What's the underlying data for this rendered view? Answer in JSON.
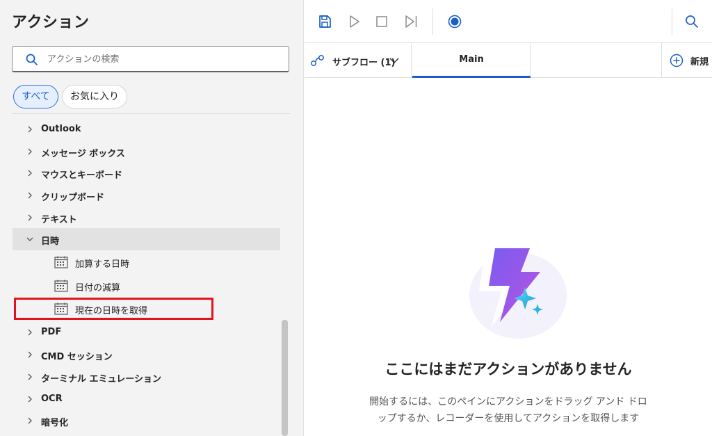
{
  "actions_pane": {
    "title": "アクション",
    "search": {
      "placeholder": "アクションの検索",
      "value": ""
    },
    "filters": [
      {
        "label": "すべて",
        "selected": true
      },
      {
        "label": "お気に入り",
        "selected": false
      }
    ],
    "tree": [
      {
        "label": "Outlook",
        "expanded": false
      },
      {
        "label": "メッセージ ボックス",
        "expanded": false
      },
      {
        "label": "マウスとキーボード",
        "expanded": false
      },
      {
        "label": "クリップボード",
        "expanded": false
      },
      {
        "label": "テキスト",
        "expanded": false
      },
      {
        "label": "日時",
        "expanded": true
      },
      {
        "label": "PDF",
        "expanded": false
      },
      {
        "label": "CMD セッション",
        "expanded": false
      },
      {
        "label": "ターミナル エミュレーション",
        "expanded": false
      },
      {
        "label": "OCR",
        "expanded": false
      },
      {
        "label": "暗号化",
        "expanded": false
      }
    ],
    "datetime_actions": [
      {
        "label": "加算する日時",
        "highlighted": false
      },
      {
        "label": "日付の減算",
        "highlighted": false
      },
      {
        "label": "現在の日時を取得",
        "highlighted": true
      }
    ]
  },
  "toolbar": {
    "buttons": [
      "save-icon",
      "run-icon",
      "stop-icon",
      "step-icon",
      "record-icon",
      "search-icon"
    ]
  },
  "tabs": {
    "subflow_label": "サブフロー (1)",
    "main_label": "Main",
    "new_label": "新規"
  },
  "canvas": {
    "empty_title": "ここにはまだアクションがありません",
    "empty_description": "開始するには、このペインにアクションをドラッグ アンド ドロップするか、レコーダーを使用してアクションを取得します"
  },
  "colors": {
    "accent": "#1a5fc9",
    "highlight": "#e0141e",
    "pane_background": "#f3f3f3"
  }
}
